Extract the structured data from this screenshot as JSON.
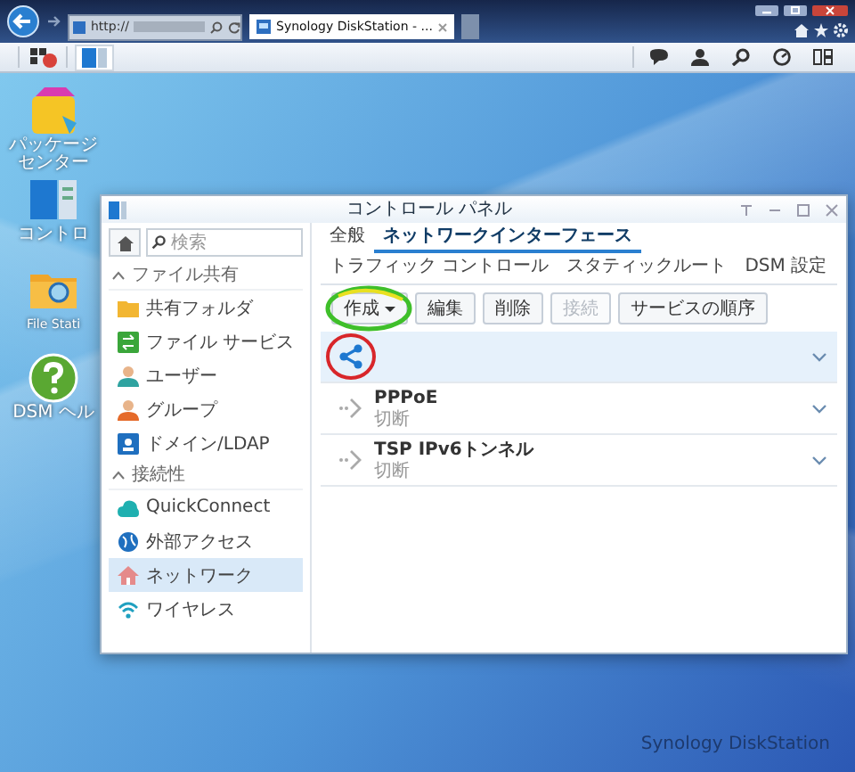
{
  "browser": {
    "address": "http://",
    "tabs": [
      {
        "label": "Synology DiskStation - ...",
        "selected": true
      }
    ]
  },
  "desktop_icons": [
    {
      "lines": [
        "パッケージ",
        "センター"
      ]
    },
    {
      "lines": [
        "コントロ"
      ]
    },
    {
      "lines": [
        "File Stati"
      ]
    },
    {
      "lines": [
        "DSM ヘル"
      ]
    }
  ],
  "window": {
    "title": "コントロール パネル",
    "search": {
      "placeholder": "検索"
    },
    "sidebar": [
      {
        "label": "ファイル共有",
        "expanded": true,
        "items": [
          {
            "label": "共有フォルダ",
            "selected": false
          },
          {
            "label": "ファイル サービス",
            "selected": false
          },
          {
            "label": "ユーザー",
            "selected": false
          },
          {
            "label": "グループ",
            "selected": false
          },
          {
            "label": "ドメイン/LDAP",
            "selected": false
          }
        ]
      },
      {
        "label": "接続性",
        "expanded": true,
        "items": [
          {
            "label": "QuickConnect",
            "selected": false
          },
          {
            "label": "外部アクセス",
            "selected": false
          },
          {
            "label": "ネットワーク",
            "selected": true
          },
          {
            "label": "ワイヤレス",
            "selected": false
          }
        ]
      }
    ],
    "tabs": [
      {
        "label": "全般",
        "selected": false
      },
      {
        "label": "ネットワークインターフェース",
        "selected": true
      },
      {
        "label": "トラフィック コントロール",
        "selected": false
      },
      {
        "label": "スタティックルート",
        "selected": false
      },
      {
        "label": "DSM 設定",
        "selected": false
      }
    ],
    "toolbar": [
      {
        "label": "作成",
        "dropdown": true,
        "disabled": false
      },
      {
        "label": "編集",
        "dropdown": false,
        "disabled": false
      },
      {
        "label": "削除",
        "dropdown": false,
        "disabled": false
      },
      {
        "label": "接続",
        "dropdown": false,
        "disabled": true
      },
      {
        "label": "サービスの順序",
        "dropdown": false,
        "disabled": false
      }
    ],
    "interfaces": [
      {
        "kind": "share",
        "selected": true,
        "expanded": false
      },
      {
        "kind": "tunnel",
        "name": "PPPoE",
        "status": "切断",
        "selected": false,
        "expanded": false
      },
      {
        "kind": "tunnel",
        "name": "TSP IPv6トンネル",
        "status": "切断",
        "selected": false,
        "expanded": false
      }
    ]
  },
  "wallpaper_logo": "Synology DiskStation"
}
